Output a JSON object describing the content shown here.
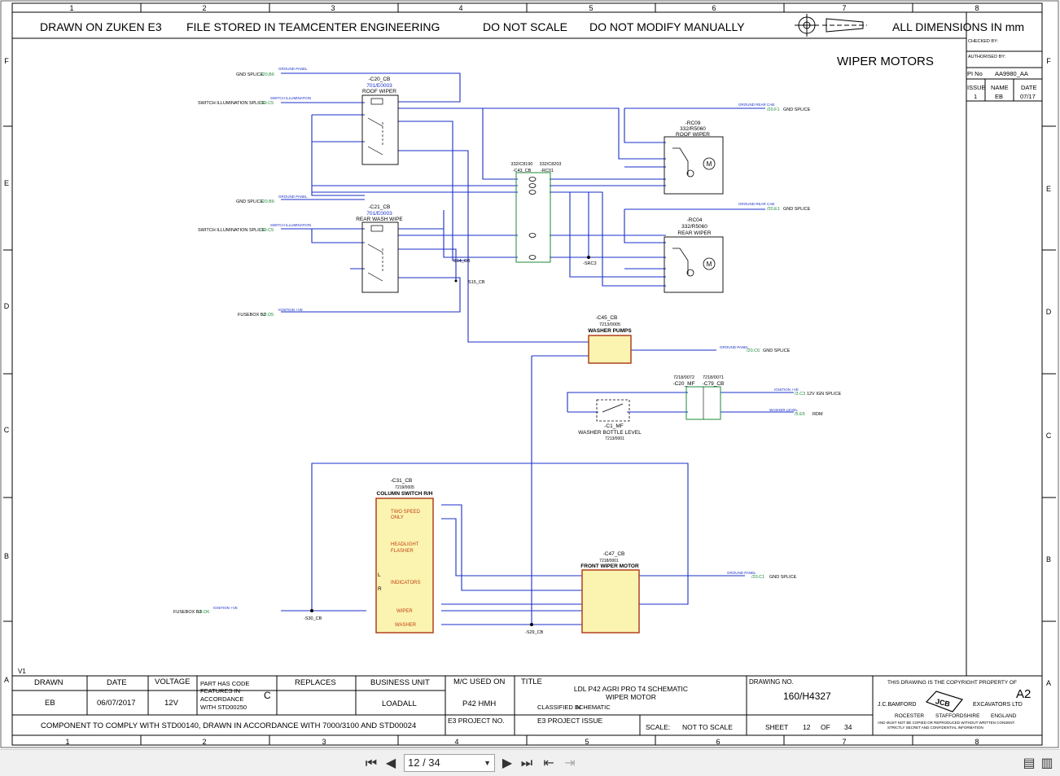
{
  "grid": {
    "cols": [
      "1",
      "2",
      "3",
      "4",
      "5",
      "6",
      "7",
      "8"
    ],
    "rows": [
      "F",
      "E",
      "D",
      "C",
      "B",
      "A"
    ]
  },
  "header": {
    "drawn_on": "DRAWN ON ZUKEN E3",
    "file_stored": "FILE STORED IN TEAMCENTER ENGINEERING",
    "do_not_scale": "DO NOT SCALE",
    "do_not_modify": "DO NOT MODIFY MANUALLY",
    "dimensions": "ALL DIMENSIONS IN mm"
  },
  "sheet_title": "WIPER MOTORS",
  "revision_box": {
    "checked_by": "CHECKED BY:",
    "authorised_by": "AUTHORISED BY:",
    "pi_no_label": "PI No",
    "pi_no": "AA9980_AA",
    "issue_label": "ISSUE",
    "name_label": "NAME",
    "date_label": "DATE",
    "issue": "1",
    "name": "EB",
    "date": "07/17"
  },
  "components": {
    "c20": {
      "ref": "-C20_CB",
      "part": "701/E0003",
      "name": "ROOF WIPER"
    },
    "c21": {
      "ref": "-C21_CB",
      "part": "701/E0003",
      "name": "REAR WASH WIPE"
    },
    "c43": {
      "ref": "-C43_CB",
      "part": "332/C8190",
      "ref2": "-RC01",
      "part2": "332/C8203"
    },
    "rc09": {
      "ref": "-RC09",
      "part": "332/R5060",
      "name": "ROOF WIPER"
    },
    "rc04": {
      "ref": "-RC04",
      "part": "332/R5060",
      "name": "REAR WIPER"
    },
    "c45": {
      "ref": "-C45_CB",
      "part": "7213/0005",
      "name": "WASHER PUMPS"
    },
    "c20mf": {
      "ref": "-C20_MF",
      "part": "7218/0072"
    },
    "c79": {
      "ref": "-C79_CB",
      "part": "7218/0071"
    },
    "c1mf": {
      "ref": "-C1_MF",
      "name": "WASHER BOTTLE LEVEL",
      "part": "7213/0001"
    },
    "c31": {
      "ref": "-C31_CB",
      "part": "7219/0005",
      "name": "COLUMN SWITCH R/H"
    },
    "c47": {
      "ref": "-C47_CB",
      "part": "7218/0001",
      "name": "FRONT WIPER MOTOR"
    }
  },
  "switch_functions": {
    "two_speed": "TWO SPEED",
    "only": "ONLY",
    "headlight": "HEADLIGHT",
    "flasher": "FLASHER",
    "indicators": "INDICATORS",
    "wiper": "WIPER",
    "washer": "WASHER",
    "l": "L",
    "r": "R"
  },
  "refs": {
    "gnd_splice_1": "GND SPLICE",
    "gnd_splice_1_ref": "/20.B6",
    "ground_panel": "GROUND PANEL",
    "switch_illum_1": "SWITCH ILLUMINATION SPLICE",
    "switch_illum_1_ref": "/19.C5",
    "switch_illumination": "SWITCH ILLUMINATION",
    "gnd_splice_2": "GND SPLICE",
    "gnd_splice_2_ref": "/20.B6",
    "switch_illum_2": "SWITCH ILLUMINATION SPLICE",
    "switch_illum_2_ref": "/19.C5",
    "fusebox_b2": "FUSEBOX B2",
    "fusebox_b2_ref": "/3.D5",
    "ignition_ve": "IGNITION +VE",
    "ground_rear_cab": "GROUND REAR CAB",
    "gnd_f1_ref": "/20.F1",
    "gnd_f1": "GND SPLICE",
    "gnd_e1_ref": "/20.E1",
    "gnd_e1": "GND SPLICE",
    "gnd_c6_ref": "/20.C6",
    "gnd_c6": "GND SPLICE",
    "ign_c3_ref": "/3.C3",
    "ign_c3": "12V IGN SPLICE",
    "washer_level": "WASHER LEVEL",
    "rdm_ref": "/5.E5",
    "rdm": "RDM",
    "gnd_c1_ref": "/20.C1",
    "gnd_c1": "GND SPLICE",
    "fusebox_b3": "FUSEBOX B3",
    "fusebox_b3_ref": "/3.D6",
    "s14": "S14_CB",
    "s15": "S15_CB",
    "src3": "-SRC3",
    "s30": "-S30_CB",
    "s29": "-S29_CB"
  },
  "version": "V1",
  "title_block": {
    "drawn_label": "DRAWN",
    "date_label": "DATE",
    "voltage_label": "VOLTAGE",
    "part_code_l1": "PART HAS CODE",
    "part_code_l2": "FEATURES IN",
    "part_code_l3": "ACCORDANCE",
    "part_code_l4": "WITH STD00250",
    "part_code_class": "C",
    "replaces_label": "REPLACES",
    "business_unit_label": "BUSINESS UNIT",
    "mc_used_label": "M/C USED ON",
    "title_label": "TITLE",
    "title_l1": "LDL P42 AGRI PRO T4 SCHEMATIC",
    "title_l2": "WIPER MOTOR",
    "classified_label": "CLASSIFIED IN",
    "classified": "SCHEMATIC",
    "drawing_no_label": "DRAWING NO.",
    "drawing_no": "160/H4327",
    "copyright": "THIS DRAWING IS THE COPYRIGHT PROPERTY OF",
    "size": "A2",
    "company_l1": "J.C.BAMFORD",
    "company_l2": "EXCAVATORS LTD",
    "logo_text": "JCB",
    "rocester": "ROCESTER",
    "staffordshire": "STAFFORDSHIRE",
    "england": "ENGLAND",
    "disclaimer_l1": "AND MUST NOT BE COPIED OR REPRODUCED WITHOUT WRITTEN CONSENT.",
    "disclaimer_l2": "STRICTLY SECRET AND CONFIDENTIAL INFORMATION",
    "drawn": "EB",
    "date": "06/07/2017",
    "voltage": "12V",
    "business_unit": "LOADALL",
    "mc_used": "P42 HMH",
    "comply": "COMPONENT TO COMPLY WITH STD00140, DRAWN IN ACCORDANCE WITH 7000/3100 AND STD00024",
    "e3_project_no": "E3 PROJECT NO.",
    "e3_project_issue": "E3 PROJECT ISSUE",
    "scale_label": "SCALE:",
    "scale": "NOT TO SCALE",
    "sheet_label": "SHEET",
    "sheet": "12",
    "of": "OF",
    "sheet_total": "34"
  },
  "viewer": {
    "page_indicator": "12 / 34"
  }
}
